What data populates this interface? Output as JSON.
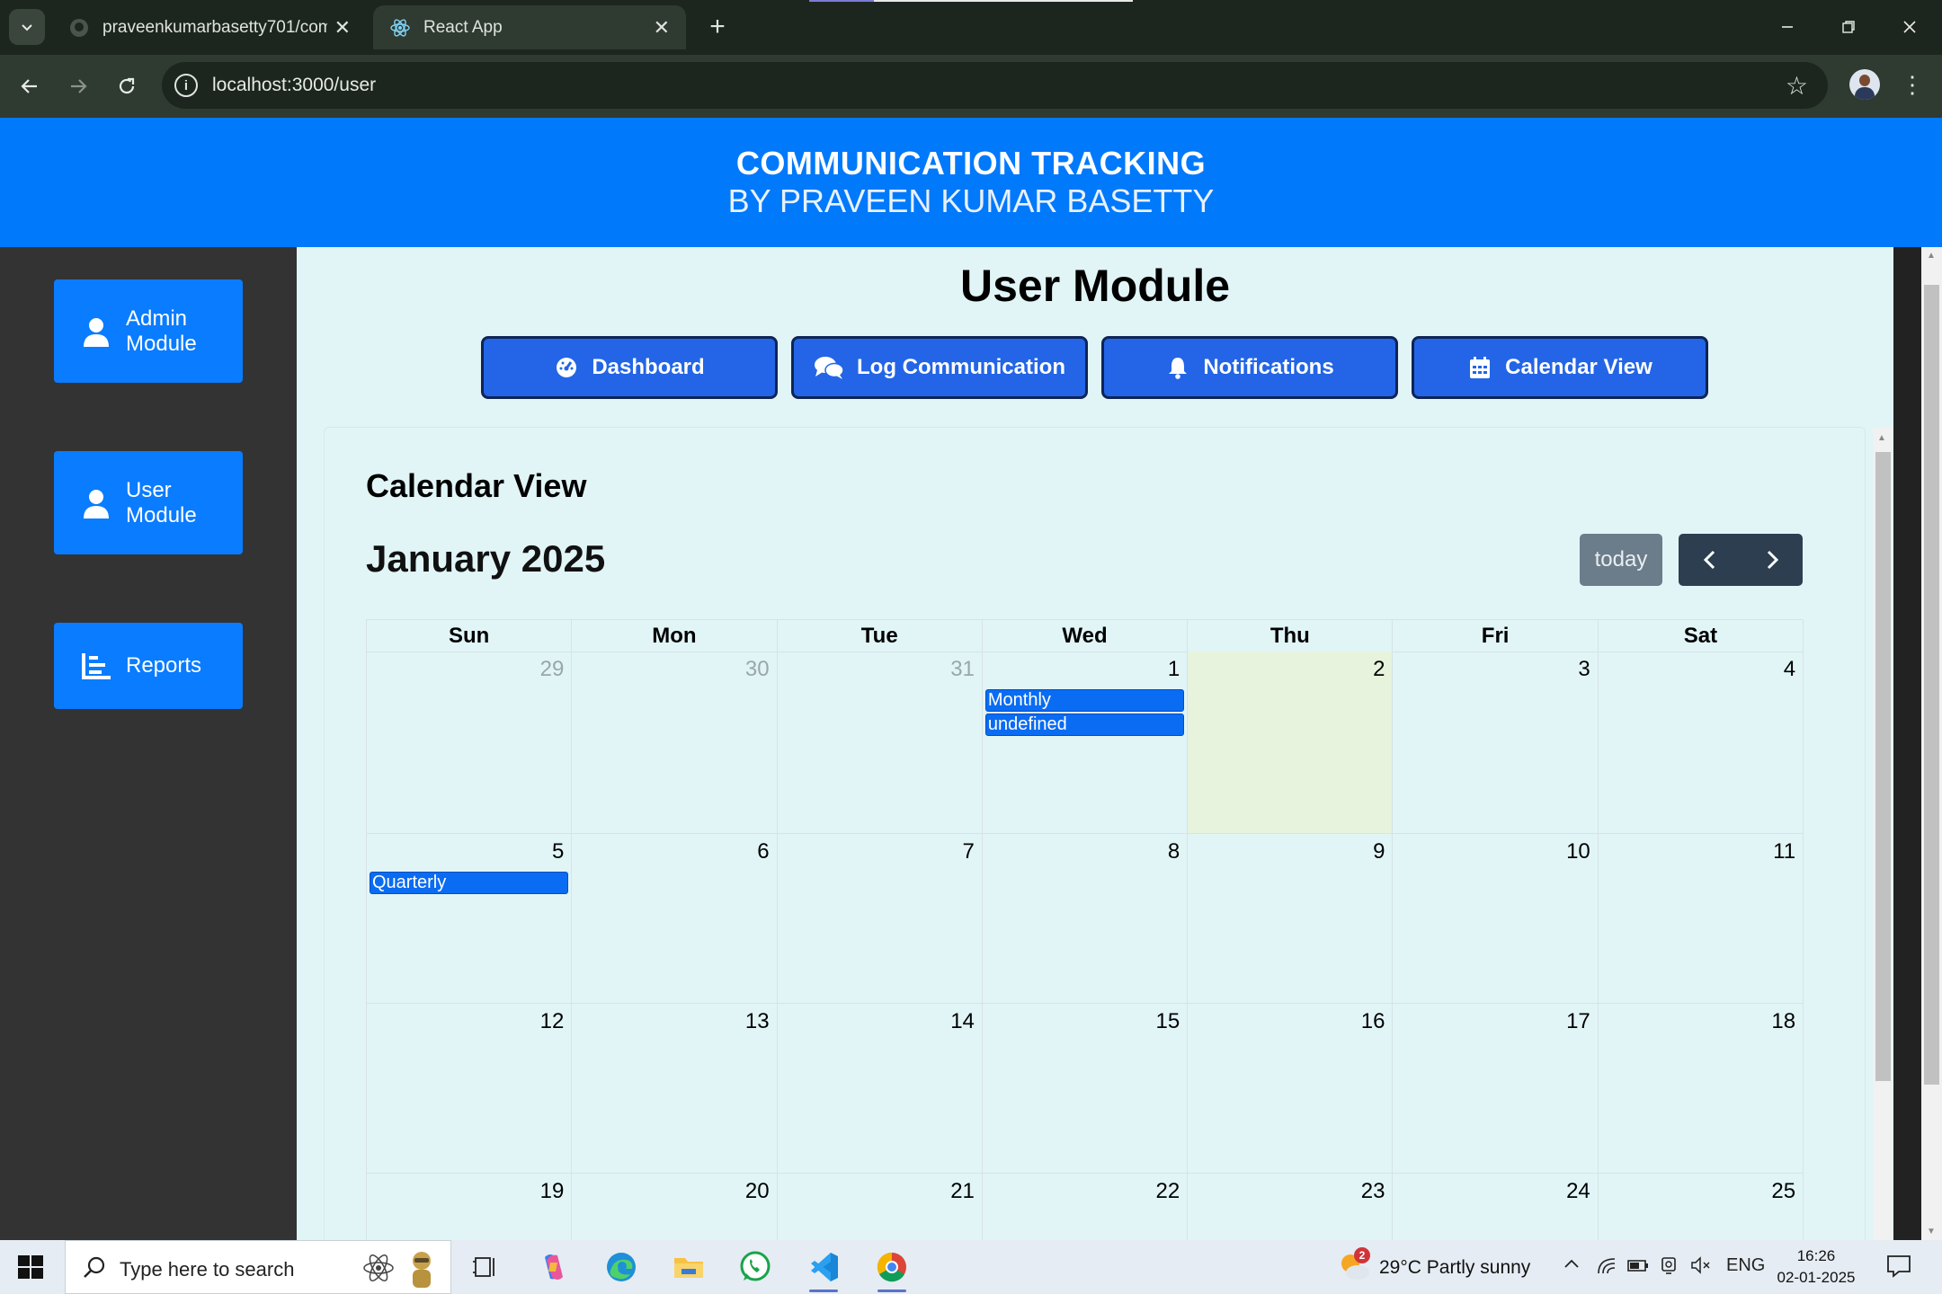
{
  "browser": {
    "tabs": [
      {
        "title": "praveenkumarbasetty701/comm",
        "icon": "github-icon"
      },
      {
        "title": "React App",
        "icon": "react-icon"
      }
    ],
    "url": "localhost:3000/user"
  },
  "header": {
    "title": "COMMUNICATION TRACKING",
    "subtitle": "BY PRAVEEN KUMAR BASETTY"
  },
  "sidebar": {
    "items": [
      {
        "label": "Admin Module",
        "icon": "user-icon"
      },
      {
        "label": "User Module",
        "icon": "user-icon"
      },
      {
        "label": "Reports",
        "icon": "bar-chart-icon"
      }
    ]
  },
  "page": {
    "title": "User Module",
    "nav": [
      {
        "label": "Dashboard",
        "icon": "gauge-icon"
      },
      {
        "label": "Log Communication",
        "icon": "comments-icon"
      },
      {
        "label": "Notifications",
        "icon": "bell-icon"
      },
      {
        "label": "Calendar View",
        "icon": "calendar-icon"
      }
    ]
  },
  "calendar": {
    "panel_title": "Calendar View",
    "month_title": "January 2025",
    "today_label": "today",
    "weekdays": [
      "Sun",
      "Mon",
      "Tue",
      "Wed",
      "Thu",
      "Fri",
      "Sat"
    ],
    "weeks": [
      [
        "29",
        "30",
        "31",
        "1",
        "2",
        "3",
        "4"
      ],
      [
        "5",
        "6",
        "7",
        "8",
        "9",
        "10",
        "11"
      ],
      [
        "12",
        "13",
        "14",
        "15",
        "16",
        "17",
        "18"
      ],
      [
        "19",
        "20",
        "21",
        "22",
        "23",
        "24",
        "25"
      ]
    ],
    "other_month_days": [
      "29",
      "30",
      "31"
    ],
    "today_date": "2",
    "events": {
      "jan1": [
        "Monthly",
        "undefined"
      ],
      "jan5": [
        "Quarterly"
      ]
    }
  },
  "taskbar": {
    "search_placeholder": "Type here to search",
    "weather_badge": "2",
    "weather": "29°C  Partly sunny",
    "language": "ENG",
    "time": "16:26",
    "date": "02-01-2025"
  },
  "colors": {
    "header_blue": "#0079fb",
    "nav_button": "#2365e6",
    "event_blue": "#0a6cf2",
    "today_cell": "#e7f3dc",
    "sidebar_bg": "#333333",
    "main_bg": "#e1f5f7"
  }
}
